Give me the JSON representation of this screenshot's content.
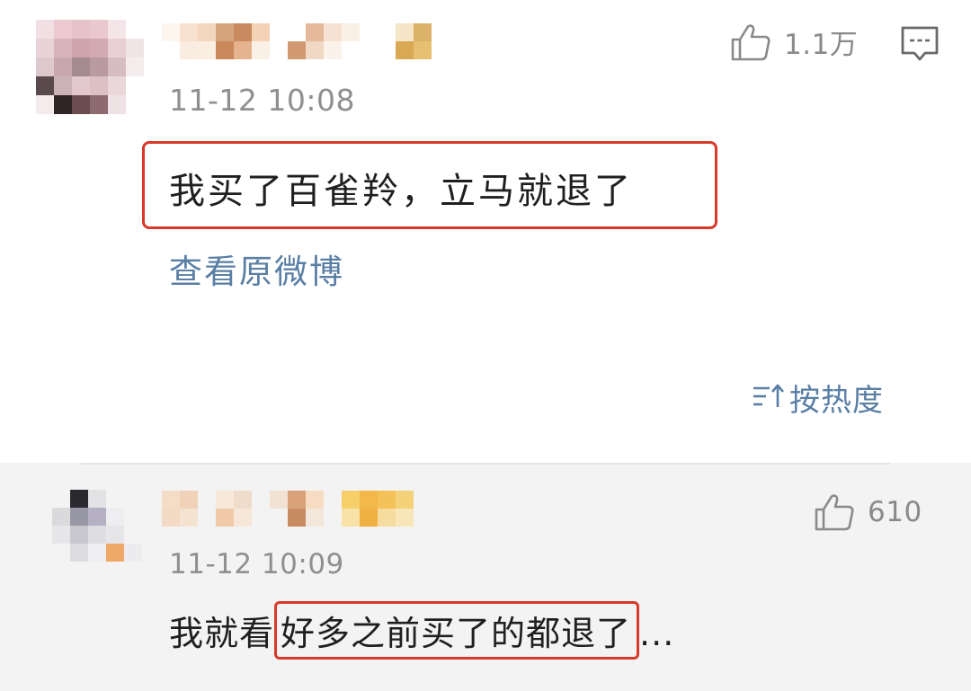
{
  "comments": [
    {
      "timestamp": "11-12 10:08",
      "likes": "1.1万",
      "text": "我买了百雀羚，立马就退了",
      "view_original_label": "查看原微博"
    },
    {
      "timestamp": "11-12 10:09",
      "likes": "610",
      "text_prefix": "我就看",
      "text_highlight": "好多之前买了的都退了",
      "text_suffix": "..."
    }
  ],
  "sort": {
    "label": "按热度"
  },
  "icons": {
    "like": "thumbs-up-icon",
    "reply": "comment-bubble-icon",
    "sort": "sort-lines-icon"
  },
  "colors": {
    "highlight_border": "#d8392b",
    "link_blue": "#5a7fa5",
    "timestamp_gray": "#8f8f8f",
    "reply_background": "#f3f3f3"
  }
}
